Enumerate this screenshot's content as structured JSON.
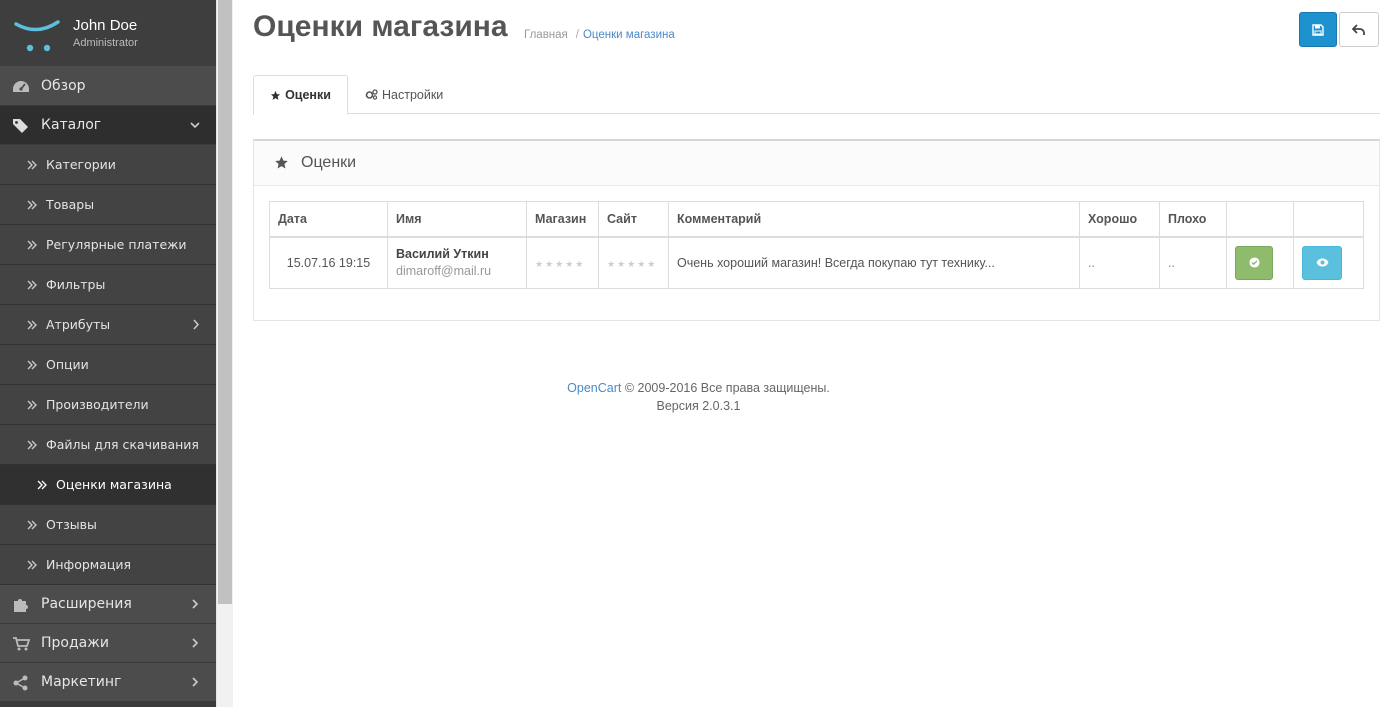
{
  "user": {
    "name": "John Doe",
    "role": "Administrator"
  },
  "nav": [
    {
      "label": "Обзор",
      "icon": "dashboard-icon"
    },
    {
      "label": "Каталог",
      "icon": "tags-icon"
    },
    {
      "label": "Расширения",
      "icon": "puzzle-icon"
    },
    {
      "label": "Продажи",
      "icon": "cart-icon"
    },
    {
      "label": "Маркетинг",
      "icon": "share-icon"
    }
  ],
  "catalog_items": [
    {
      "label": "Категории"
    },
    {
      "label": "Товары"
    },
    {
      "label": "Регулярные платежи"
    },
    {
      "label": "Фильтры"
    },
    {
      "label": "Атрибуты"
    },
    {
      "label": "Опции"
    },
    {
      "label": "Производители"
    },
    {
      "label": "Файлы для скачивания"
    },
    {
      "label": "Оценки магазина"
    },
    {
      "label": "Отзывы"
    },
    {
      "label": "Информация"
    }
  ],
  "page": {
    "title": "Оценки магазина",
    "breadcrumb": [
      "Главная",
      "/",
      "Оценки магазина"
    ]
  },
  "tabs": [
    {
      "label": "Оценки"
    },
    {
      "label": "Настройки"
    }
  ],
  "panel": {
    "title": "Оценки"
  },
  "table": {
    "headers": [
      "Дата",
      "Имя",
      "Магазин",
      "Сайт",
      "Комментарий",
      "Хорошо",
      "Плохо"
    ],
    "rows": [
      {
        "date": "15.07.16 19:15",
        "name": "Василий Уткин",
        "email": "dimaroff@mail.ru",
        "shop_stars": "★★★★★",
        "site_stars": "★★★★★",
        "comment": "Очень хороший магазин! Всегда покупаю тут технику...",
        "good": "..",
        "bad": ".."
      }
    ]
  },
  "footer": {
    "link": "OpenCart",
    "copyright": " © 2009-2016 Все права защищены.",
    "version": "Версия 2.0.3.1"
  },
  "colors": {
    "primary": "#1e91cf",
    "success": "#8fbb6c",
    "info": "#5bc0de",
    "link": "#4a8ac5",
    "sidebar": "#3a3a3a"
  }
}
